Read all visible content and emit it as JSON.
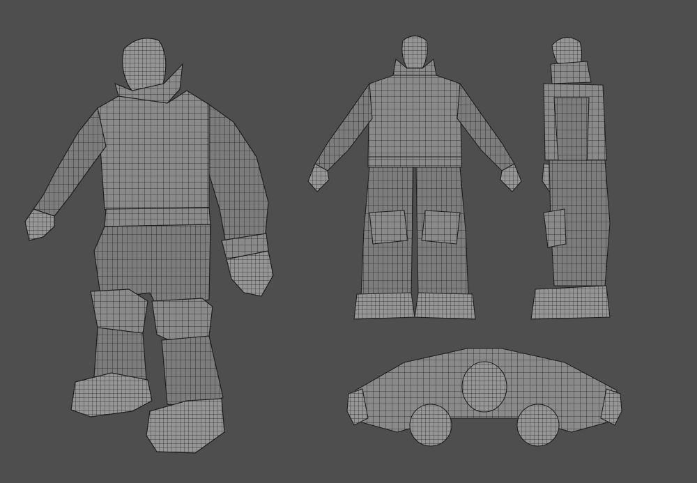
{
  "scene": {
    "background_color": "#4e4e4e",
    "mesh_color": "#8a8a8a",
    "wire_color": "#1e1e1e",
    "views": [
      {
        "id": "perspective",
        "icon": "character-mesh-perspective"
      },
      {
        "id": "front",
        "icon": "character-mesh-front"
      },
      {
        "id": "side",
        "icon": "character-mesh-side"
      },
      {
        "id": "top",
        "icon": "character-mesh-top"
      }
    ]
  }
}
